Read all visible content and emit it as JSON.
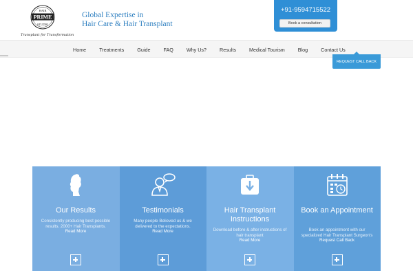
{
  "header": {
    "logo_lines": [
      "HAIR",
      "PRIME",
      "STUDIO"
    ],
    "logo_tagline": "Transplant for Transformation",
    "tagline_line1": "Global Expertise in",
    "tagline_line2": "Hair Care & Hair Transplant",
    "phone": "+91-9594715522",
    "consult_button": "Book a consultation"
  },
  "nav": {
    "items": [
      "Home",
      "Treatments",
      "Guide",
      "FAQ",
      "Why Us?",
      "Results",
      "Medical Tourism",
      "Blog",
      "Contact Us"
    ]
  },
  "request_call_back": "REQUEST CALL BACK",
  "features": [
    {
      "icon": "head-silhouette-icon",
      "title": "Our Results",
      "body": "Consistently producing best possible results. 2000+ Hair Transplants.",
      "link": "Read More",
      "color": "#7aaee1"
    },
    {
      "icon": "person-speech-icon",
      "title": "Testimonials",
      "body": "Many people Believed us & we delivered to the expectations.",
      "link": "Read More",
      "color": "#5d9cd8"
    },
    {
      "icon": "download-tray-icon",
      "title": "Hair Transplant Instructions",
      "body": "Download before & after instructions of hair transplant",
      "link": "Read More",
      "color": "#7ab1e5"
    },
    {
      "icon": "calendar-clock-icon",
      "title": "Book an Appointment",
      "body": "Book an appointment with our specialized Hair Transplant Surgeon's",
      "link": "Request Call Back",
      "color": "#5fa0da"
    }
  ]
}
